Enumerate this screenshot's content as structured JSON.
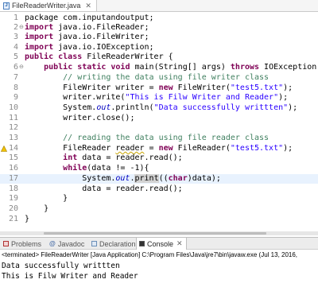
{
  "editor": {
    "tab_title": "FileReaderWriter.java",
    "tab_icon": "java-file-icon",
    "close_glyph": "✕",
    "lines": [
      {
        "n": "1",
        "fold": "",
        "marker": "",
        "segs": [
          [
            "",
            "package com.inputandoutput;"
          ]
        ]
      },
      {
        "n": "2",
        "fold": "⊖",
        "marker": "",
        "segs": [
          [
            "kw",
            "import"
          ],
          [
            "",
            " java.io.FileReader;"
          ]
        ]
      },
      {
        "n": "3",
        "fold": "",
        "marker": "",
        "segs": [
          [
            "kw",
            "import"
          ],
          [
            "",
            " java.io.FileWriter;"
          ]
        ]
      },
      {
        "n": "4",
        "fold": "",
        "marker": "",
        "segs": [
          [
            "kw",
            "import"
          ],
          [
            "",
            " java.io.IOException;"
          ]
        ]
      },
      {
        "n": "5",
        "fold": "",
        "marker": "",
        "segs": [
          [
            "kw",
            "public class"
          ],
          [
            "",
            " FileReaderWriter {"
          ]
        ]
      },
      {
        "n": "6",
        "fold": "⊖",
        "marker": "",
        "segs": [
          [
            "",
            "    "
          ],
          [
            "kw",
            "public static void"
          ],
          [
            "",
            " main(String[] args) "
          ],
          [
            "kw",
            "throws"
          ],
          [
            "",
            " IOException {"
          ]
        ]
      },
      {
        "n": "7",
        "fold": "",
        "marker": "",
        "segs": [
          [
            "cm",
            "        // writing the data using file writer class"
          ]
        ]
      },
      {
        "n": "8",
        "fold": "",
        "marker": "",
        "segs": [
          [
            "",
            "        FileWriter writer = "
          ],
          [
            "kw",
            "new"
          ],
          [
            "",
            " FileWriter("
          ],
          [
            "str",
            "\"test5.txt\""
          ],
          [
            "",
            ");"
          ]
        ]
      },
      {
        "n": "9",
        "fold": "",
        "marker": "",
        "segs": [
          [
            "",
            "        writer.write("
          ],
          [
            "str",
            "\"This is Filw Writer and Reader\""
          ],
          [
            "",
            ");"
          ]
        ]
      },
      {
        "n": "10",
        "fold": "",
        "marker": "",
        "segs": [
          [
            "",
            "        System."
          ],
          [
            "fld",
            "out"
          ],
          [
            ".println(",
            ""
          ],
          [
            "str",
            "\"Data successfully writtten\""
          ],
          [
            "",
            ");"
          ]
        ]
      },
      {
        "n": "11",
        "fold": "",
        "marker": "",
        "segs": [
          [
            "",
            "        writer.close();"
          ]
        ]
      },
      {
        "n": "12",
        "fold": "",
        "marker": "",
        "segs": [
          [
            "",
            ""
          ]
        ]
      },
      {
        "n": "13",
        "fold": "",
        "marker": "",
        "segs": [
          [
            "cm",
            "        // reading the data using file reader class"
          ]
        ]
      },
      {
        "n": "14",
        "fold": "",
        "marker": "warn",
        "segs": [
          [
            "",
            "        FileReader "
          ],
          [
            "warn",
            "reader"
          ],
          [
            "",
            " = "
          ],
          [
            "kw",
            "new"
          ],
          [
            "",
            " FileReader("
          ],
          [
            "str",
            "\"test5.txt\""
          ],
          [
            "",
            ");"
          ]
        ]
      },
      {
        "n": "15",
        "fold": "",
        "marker": "",
        "segs": [
          [
            "",
            "        "
          ],
          [
            "kw",
            "int"
          ],
          [
            "",
            " data = reader.read();"
          ]
        ]
      },
      {
        "n": "16",
        "fold": "",
        "marker": "",
        "segs": [
          [
            "",
            "        "
          ],
          [
            "kw",
            "while"
          ],
          [
            "",
            "(data != -1){"
          ]
        ]
      },
      {
        "n": "17",
        "fold": "",
        "marker": "",
        "segs": [
          [
            "",
            "            System."
          ],
          [
            "fld",
            "out"
          ],
          [
            "",
            "."
          ],
          [
            "hl",
            "print"
          ],
          [
            "",
            "(("
          ],
          [
            "kw",
            "char"
          ],
          [
            "",
            ")data);"
          ]
        ]
      },
      {
        "n": "18",
        "fold": "",
        "marker": "",
        "segs": [
          [
            "",
            "            data = reader.read();"
          ]
        ]
      },
      {
        "n": "19",
        "fold": "",
        "marker": "",
        "segs": [
          [
            "",
            "        }"
          ]
        ]
      },
      {
        "n": "20",
        "fold": "",
        "marker": "",
        "segs": [
          [
            "",
            "    }"
          ]
        ]
      },
      {
        "n": "21",
        "fold": "",
        "marker": "",
        "segs": [
          [
            "",
            "}"
          ]
        ]
      }
    ]
  },
  "panel": {
    "tabs": [
      {
        "label": "Problems",
        "icon": "problems-icon",
        "active": false
      },
      {
        "label": "Javadoc",
        "icon": "javadoc-icon",
        "active": false
      },
      {
        "label": "Declaration",
        "icon": "declaration-icon",
        "active": false
      },
      {
        "label": "Console",
        "icon": "console-icon",
        "active": true
      }
    ],
    "close_glyph": "✕",
    "console_header": "<terminated> FileReaderWriter [Java Application] C:\\Program Files\\Java\\jre7\\bin\\javaw.exe (Jul 13, 2016,",
    "output": [
      "Data successfully writtten",
      "This is Filw Writer and Reader"
    ]
  }
}
